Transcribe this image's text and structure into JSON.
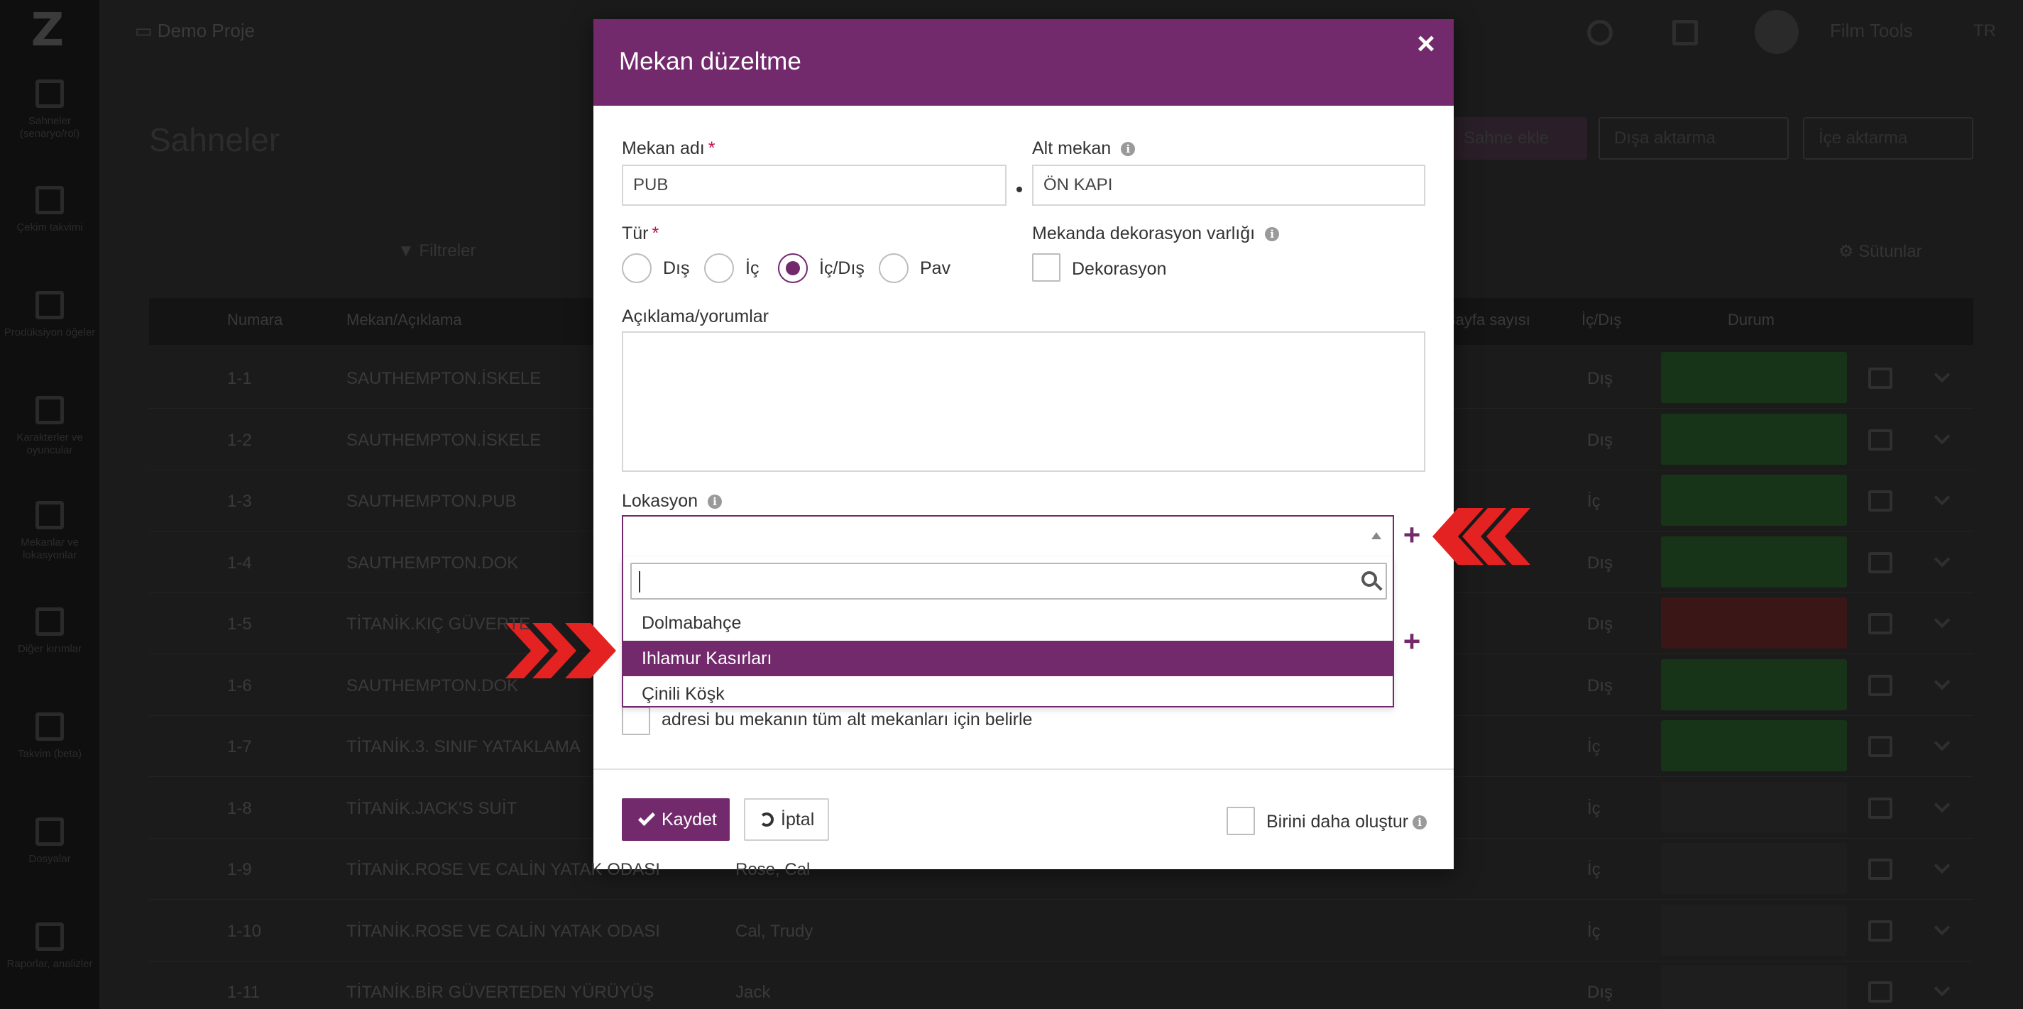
{
  "app": {
    "project": "Demo Proje",
    "user": "Film Tools",
    "language": "TR"
  },
  "sidebar": {
    "items": [
      {
        "label": "Sahneler (senaryo/rol)",
        "icon": "clapperboard-icon"
      },
      {
        "label": "Çekim takvimi",
        "icon": "calendar-icon"
      },
      {
        "label": "Prodüksiyon öğeler",
        "icon": "checkbox-icon"
      },
      {
        "label": "Karakterler ve oyuncular",
        "icon": "users-icon"
      },
      {
        "label": "Mekanlar ve lokasyonlar",
        "icon": "image-icon"
      },
      {
        "label": "Diğer kırımlar",
        "icon": "list-icon"
      },
      {
        "label": "Takvim (beta)",
        "icon": "calendar-grid-icon"
      },
      {
        "label": "Dosyalar",
        "icon": "file-icon"
      },
      {
        "label": "Raporlar, analizler",
        "icon": "bar-chart-icon"
      }
    ]
  },
  "page": {
    "title": "Sahneler",
    "add_scene": "Sahne ekle",
    "export": "Dışa aktarma",
    "import": "İçe aktarma",
    "filters": "Filtreler",
    "columns": "Sütunlar"
  },
  "table": {
    "headers": [
      "Numara",
      "Mekan/Açıklama",
      "Sayfa sayısı",
      "İç/Dış",
      "Durum"
    ],
    "rows": [
      {
        "num": "1-1",
        "place": "SAUTHEMPTON.İSKELE",
        "role": "",
        "pages": "",
        "io": "Dış",
        "status": "green"
      },
      {
        "num": "1-2",
        "place": "SAUTHEMPTON.İSKELE",
        "role": "",
        "pages": "",
        "io": "Dış",
        "status": "green"
      },
      {
        "num": "1-3",
        "place": "SAUTHEMPTON.PUB",
        "role": "",
        "pages": "",
        "io": "İç",
        "status": "green"
      },
      {
        "num": "1-4",
        "place": "SAUTHEMPTON.DOK",
        "role": "",
        "pages": "",
        "io": "Dış",
        "status": "green"
      },
      {
        "num": "1-5",
        "place": "TİTANİK.KIÇ GÜVERTE",
        "role": "",
        "pages": "",
        "io": "Dış",
        "status": "red"
      },
      {
        "num": "1-6",
        "place": "SAUTHEMPTON.DOK",
        "role": "",
        "pages": "",
        "io": "Dış",
        "status": "green"
      },
      {
        "num": "1-7",
        "place": "TİTANİK.3. SINIF YATAKLAMA",
        "role": "",
        "pages": "",
        "io": "İç",
        "status": "green"
      },
      {
        "num": "1-8",
        "place": "TİTANİK.JACK'S SUİT",
        "role": "",
        "pages": "",
        "io": "İç",
        "status": "dark"
      },
      {
        "num": "1-9",
        "place": "TİTANİK.ROSE VE CALİN YATAK ODASI",
        "role": "Rose, Cal",
        "pages": "",
        "io": "İç",
        "status": "dark"
      },
      {
        "num": "1-10",
        "place": "TİTANİK.ROSE VE CALİN YATAK ODASI",
        "role": "Cal, Trudy",
        "pages": "",
        "io": "İç",
        "status": "dark"
      },
      {
        "num": "1-11",
        "place": "TİTANİK.BİR GÜVERTEDEN YÜRÜYÜŞ",
        "role": "Jack",
        "pages": "",
        "io": "Dış",
        "status": "dark"
      }
    ]
  },
  "modal": {
    "title": "Mekan düzeltme",
    "close": "×",
    "place_name_label": "Mekan adı",
    "place_name_value": "PUB",
    "sub_place_label": "Alt mekan",
    "sub_place_value": "ÖN KAPI",
    "type_label": "Tür",
    "type_options": [
      {
        "label": "Dış",
        "checked": false
      },
      {
        "label": "İç",
        "checked": false
      },
      {
        "label": "İç/Dış",
        "checked": true
      },
      {
        "label": "Pav",
        "checked": false
      }
    ],
    "decor_label": "Mekanda dekorasyon varlığı",
    "decor_checkbox": "Dekorasyon",
    "comments_label": "Açıklama/yorumlar",
    "location_label": "Lokasyon",
    "location_options": [
      "Dolmabahçe",
      "Ihlamur Kasırları",
      "Çinili Köşk"
    ],
    "location_highlighted": "Ihlamur Kasırları",
    "address_all_text": "adresi bu mekanın tüm alt mekanları için belirle",
    "save": "Kaydet",
    "cancel": "İptal",
    "create_another": "Birini daha oluştur"
  },
  "colors": {
    "accent": "#722a6c",
    "highlight": "#722a6c",
    "required": "#c0124c",
    "annotation_arrow": "#e52222"
  }
}
